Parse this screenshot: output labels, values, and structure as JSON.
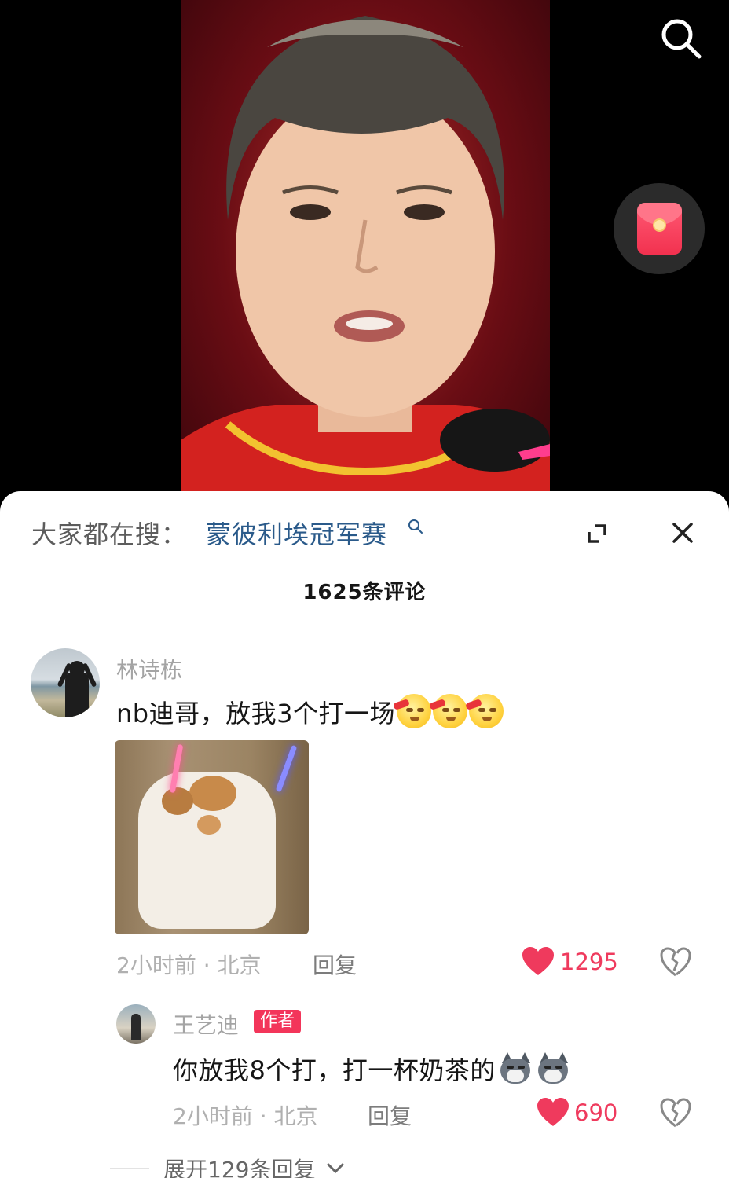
{
  "video": {
    "search_icon": "search-icon",
    "redpacket_icon": "red-envelope-icon"
  },
  "panel": {
    "search_prefix": "大家都在搜：",
    "search_term": "蒙彼利埃冠军赛",
    "comment_count_title": "1625条评论",
    "expand_icon": "fullscreen-expand-icon",
    "close_icon": "close-icon"
  },
  "comments": [
    {
      "username": "林诗栋",
      "text": "nb迪哥，放我3个打一场",
      "emoji_count": 3,
      "time_location": "2小时前 · 北京",
      "reply_label": "回复",
      "likes": "1295",
      "reply": {
        "username": "王艺迪",
        "badge": "作者",
        "text": "你放我8个打，打一杯奶茶的",
        "emoji_count": 2,
        "time_location": "2小时前 · 北京",
        "reply_label": "回复",
        "likes": "690"
      },
      "expand_replies": "展开129条回复"
    }
  ],
  "colors": {
    "accent_like": "#ef3a5d",
    "link_blue": "#2a5a8a",
    "author_badge": "#f3355a"
  }
}
